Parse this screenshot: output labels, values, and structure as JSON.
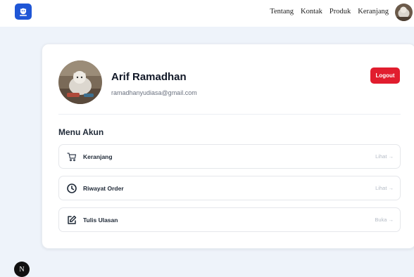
{
  "brand": {
    "logo_icon": "app-logo-icon",
    "accent": "#1f56d6"
  },
  "nav": {
    "links": [
      {
        "label": "Tentang"
      },
      {
        "label": "Kontak"
      },
      {
        "label": "Produk"
      },
      {
        "label": "Keranjang"
      }
    ],
    "avatar_icon": "user-avatar"
  },
  "profile": {
    "name": "Arif Ramadhan",
    "email": "ramadhanyudiasa@gmail.com",
    "logout_label": "Logout",
    "logout_color": "#e11d2e"
  },
  "menu": {
    "title": "Menu Akun",
    "items": [
      {
        "label": "Keranjang",
        "action": "Lihat →",
        "icon": "cart-icon"
      },
      {
        "label": "Riwayat Order",
        "action": "Lihat →",
        "icon": "clock-icon"
      },
      {
        "label": "Tulis Ulasan",
        "action": "Buka →",
        "icon": "edit-icon"
      }
    ]
  },
  "dev_badge": {
    "label": "N"
  }
}
